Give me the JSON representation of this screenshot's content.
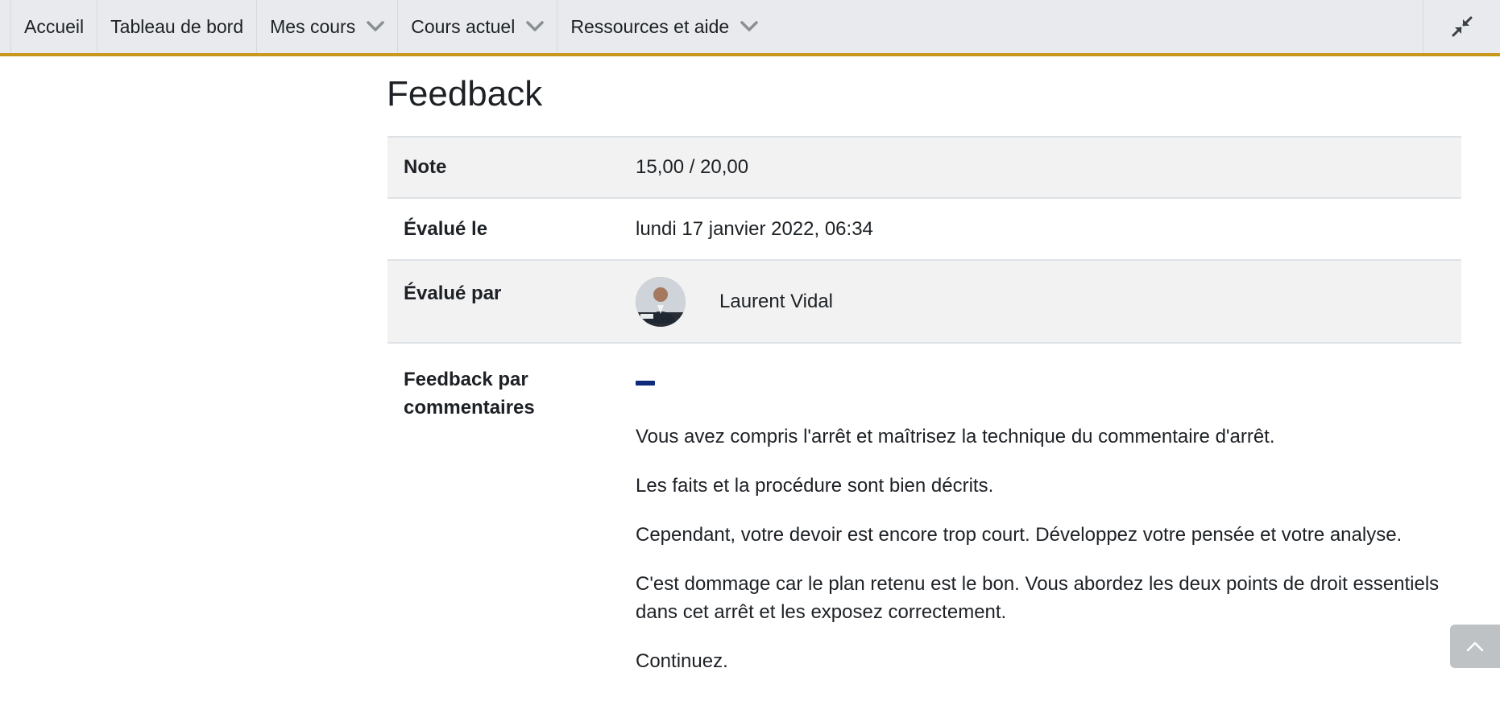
{
  "nav": {
    "items": [
      {
        "label": "Accueil",
        "dropdown": false
      },
      {
        "label": "Tableau de bord",
        "dropdown": false
      },
      {
        "label": "Mes cours",
        "dropdown": true
      },
      {
        "label": "Cours actuel",
        "dropdown": true
      },
      {
        "label": "Ressources et aide",
        "dropdown": true
      }
    ],
    "collapse_icon": "collapse-arrows-icon",
    "accent_color": "#c9981b"
  },
  "page": {
    "title": "Feedback"
  },
  "feedback": {
    "grade_label": "Note",
    "grade_value": "15,00 / 20,00",
    "graded_on_label": "Évalué le",
    "graded_on_value": "lundi 17 janvier 2022, 06:34",
    "graded_by_label": "Évalué par",
    "grader_name": "Laurent Vidal",
    "comments_label": "Feedback par commentaires",
    "comments": [
      "Vous avez compris l'arrêt et maîtrisez la technique du commentaire d'arrêt.",
      "Les faits et la procédure sont bien décrits.",
      "Cependant, votre devoir est encore trop court. Développez votre pensée et votre analyse.",
      "C'est dommage car le plan retenu est le bon. Vous abordez les deux points de droit essentiels dans cet arrêt et les exposez correctement.",
      "Continuez."
    ]
  },
  "back_to_top_icon": "chevron-up-icon"
}
